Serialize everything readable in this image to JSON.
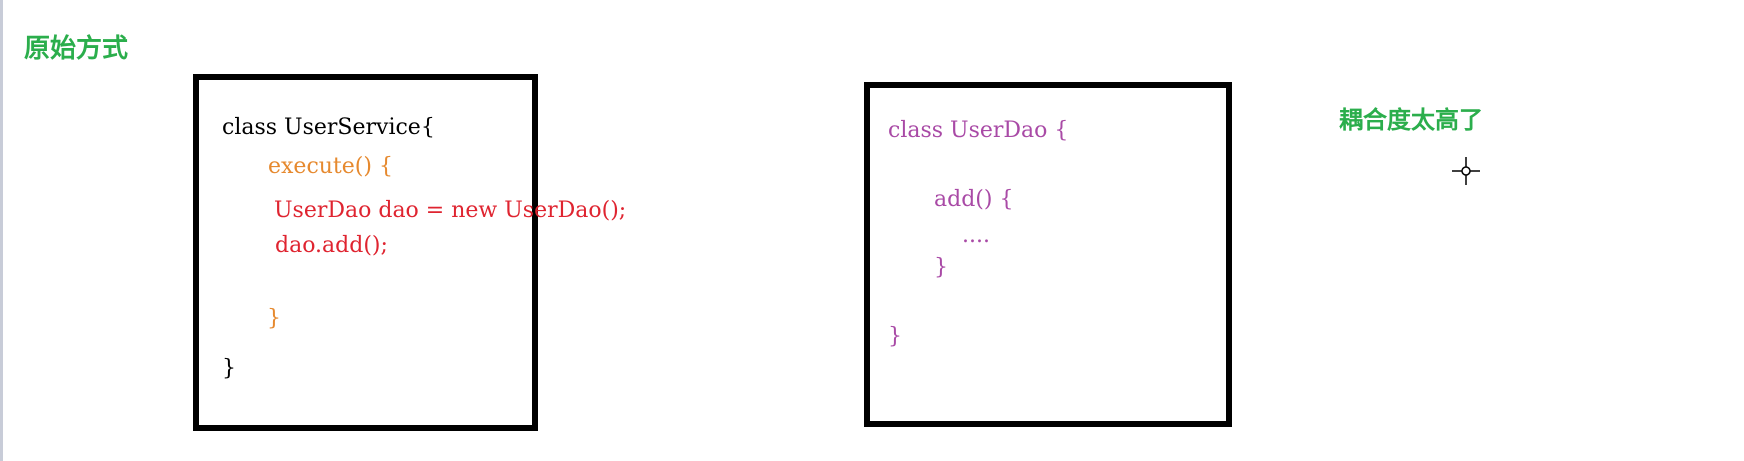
{
  "heading": "原始方式",
  "note": "耦合度太高了",
  "user_service_box": {
    "class_decl": "class UserService{",
    "method_decl": "execute() {",
    "statement_1": "UserDao dao = new UserDao();",
    "statement_2": "dao.add();",
    "method_close": "}",
    "class_close": "}"
  },
  "user_dao_box": {
    "class_decl": "class UserDao {",
    "method_decl": "add() {",
    "method_body": "....",
    "method_close": "}",
    "class_close": "}"
  },
  "colors": {
    "heading_green": "#2bae4c",
    "class_text": "#000000",
    "method_orange": "#e6892e",
    "statement_red": "#df2430",
    "dao_purple": "#a94aa6",
    "box_border": "#000000"
  },
  "icons": {
    "cursor": "crosshair-cursor-icon"
  }
}
